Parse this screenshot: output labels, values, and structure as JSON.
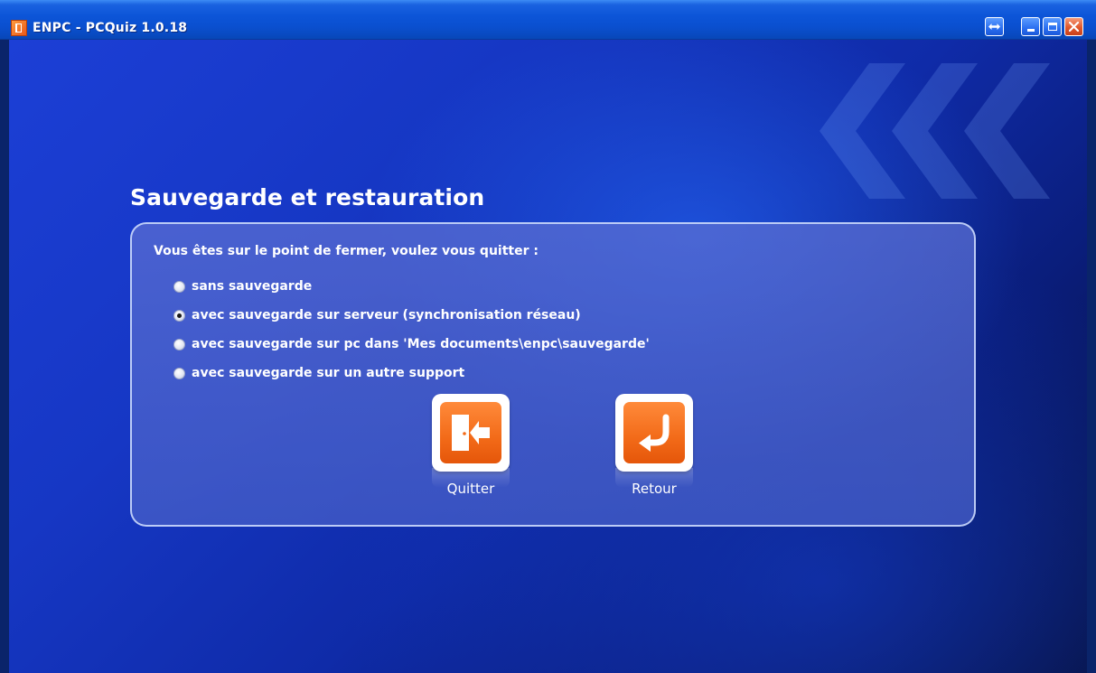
{
  "window": {
    "title": "ENPC - PCQuiz 1.0.18",
    "icon": "app-logo-icon",
    "buttons": [
      "resize-arrows-icon",
      "minimize-icon",
      "maximize-icon",
      "close-icon"
    ],
    "accent_color": "#0a4fcf",
    "close_color": "#e0582c"
  },
  "page": {
    "title": "Sauvegarde et restauration",
    "question": "Vous êtes sur le point de fermer, voulez vous quitter :",
    "options": [
      {
        "label": "sans sauvegarde",
        "checked": false
      },
      {
        "label": "avec sauvegarde sur serveur (synchronisation réseau)",
        "checked": true
      },
      {
        "label": "avec sauvegarde sur pc dans 'Mes documents\\enpc\\sauvegarde'",
        "checked": false
      },
      {
        "label": "avec sauvegarde sur un autre support",
        "checked": false
      }
    ],
    "actions": {
      "quit": {
        "label": "Quitter",
        "icon": "exit-door-icon"
      },
      "back": {
        "label": "Retour",
        "icon": "return-arrow-icon"
      }
    },
    "button_color": "#f26a18"
  }
}
